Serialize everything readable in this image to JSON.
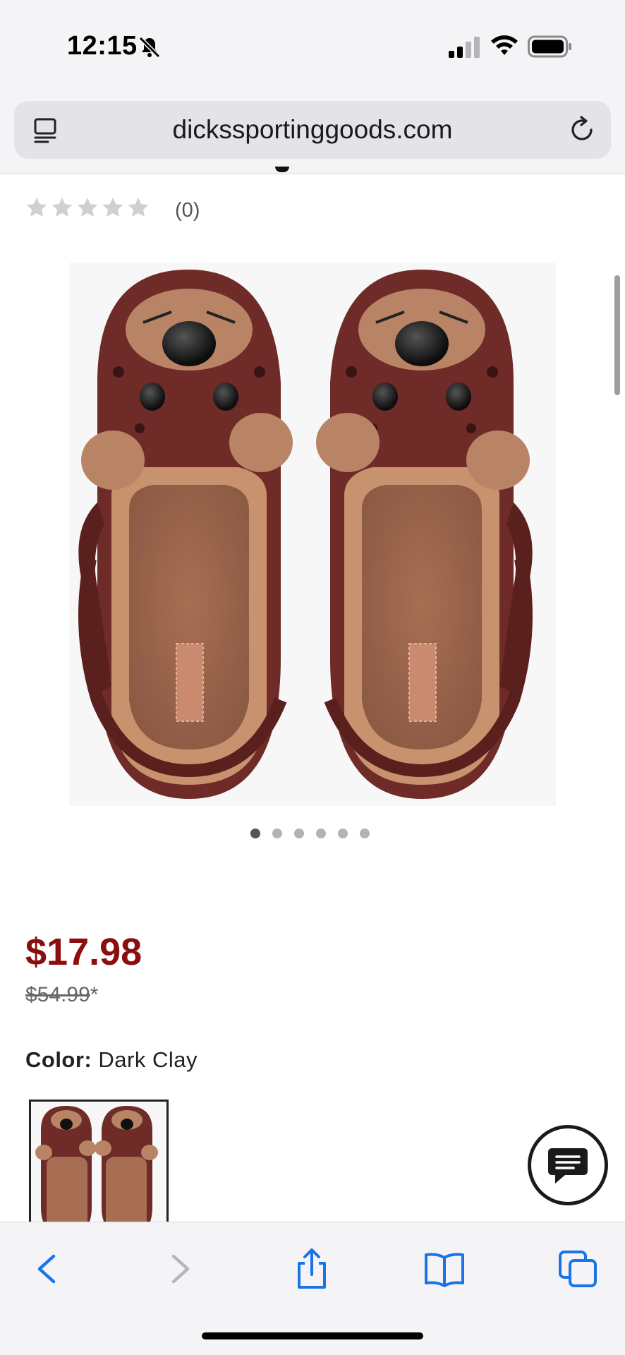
{
  "status_bar": {
    "time": "12:15",
    "icons": [
      "silent-bell-icon",
      "cellular-signal-icon",
      "wifi-icon",
      "battery-icon"
    ]
  },
  "browser": {
    "url": "dickssportinggoods.com",
    "icons": [
      "reader-mode-icon",
      "reload-icon"
    ]
  },
  "product": {
    "rating": {
      "stars": 0,
      "max_stars": 5,
      "review_count": "(0)"
    },
    "image_alt": "Dark clay clogs with plush teddy-bear lining and puppy face charms",
    "carousel": {
      "total": 6,
      "active_index": 0
    },
    "price": "$17.98",
    "original_price": "$54.99",
    "original_price_suffix": "*",
    "color_label": "Color:",
    "color_value": "Dark Clay"
  },
  "colors": {
    "sale_price": "#8c0d0d",
    "clog_body": "#6e2b27",
    "plush": "#b88465",
    "toolbar_blue": "#1a73e8"
  },
  "toolbar": {
    "buttons": [
      "back-icon",
      "forward-icon",
      "share-icon",
      "bookmarks-icon",
      "tabs-icon"
    ]
  },
  "chat": {
    "icon": "chat-icon"
  }
}
